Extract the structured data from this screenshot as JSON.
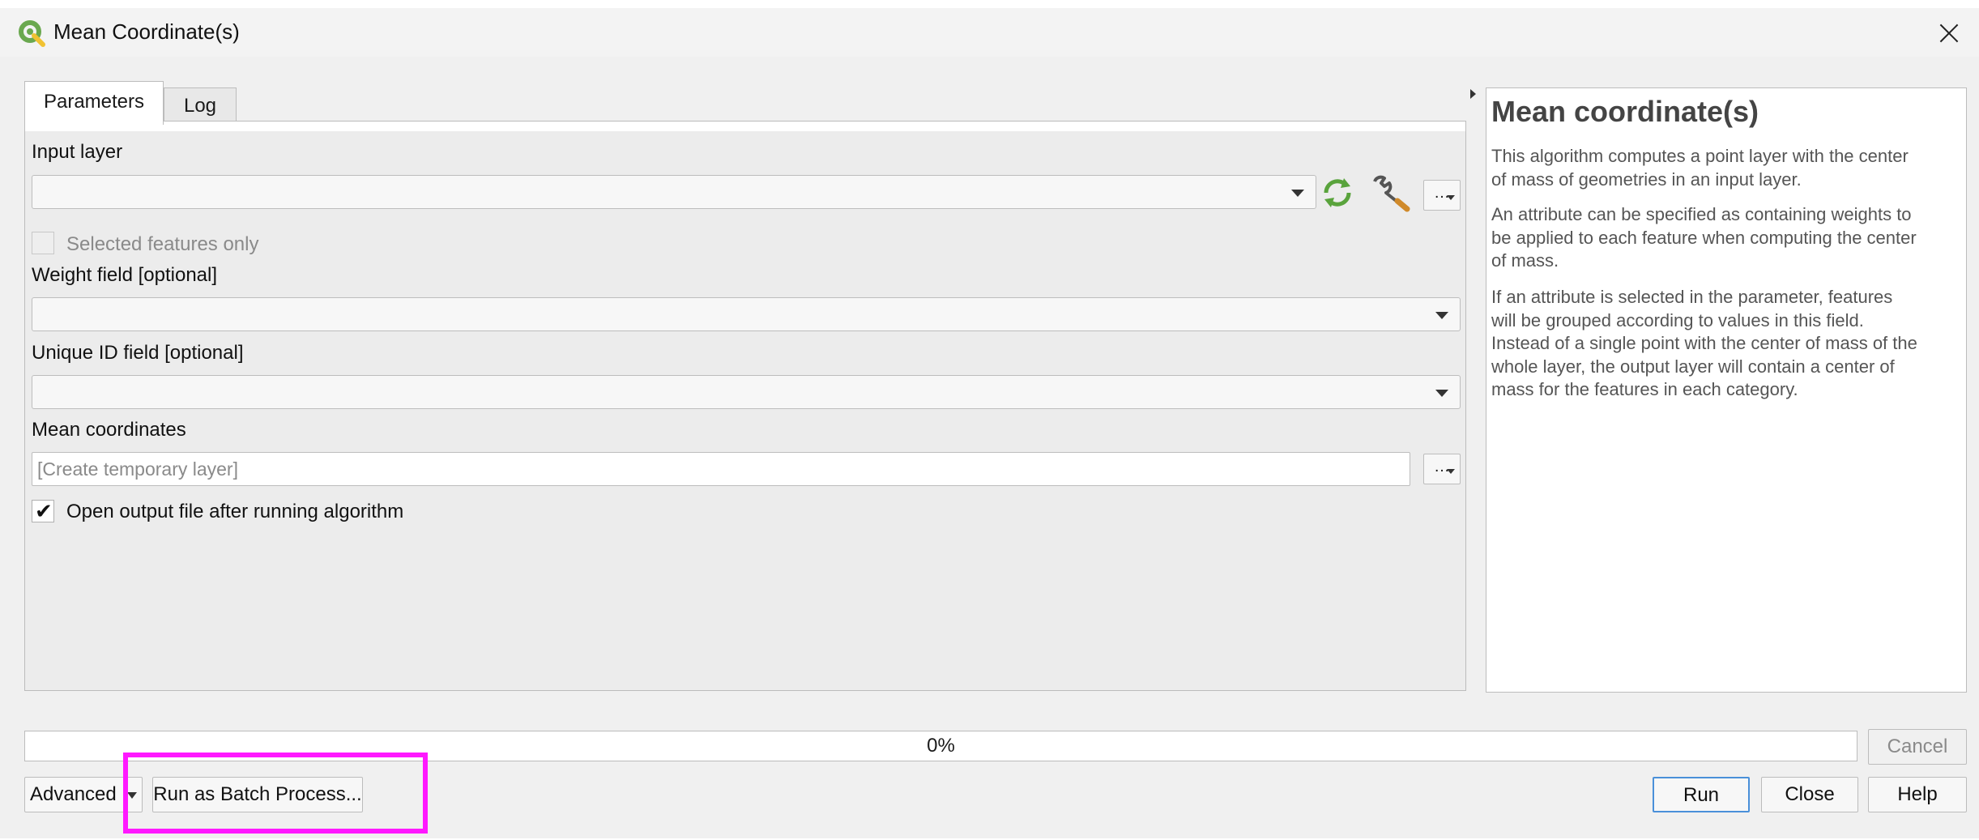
{
  "window": {
    "title": "Mean Coordinate(s)"
  },
  "tabs": [
    {
      "label": "Parameters",
      "active": true
    },
    {
      "label": "Log",
      "active": false
    }
  ],
  "params": {
    "input_layer_label": "Input layer",
    "input_layer_value": "",
    "selected_only_label": "Selected features only",
    "weight_label": "Weight field [optional]",
    "weight_value": "",
    "uid_label": "Unique ID field [optional]",
    "uid_value": "",
    "mean_label": "Mean coordinates",
    "mean_placeholder": "[Create temporary layer]",
    "dots": "…",
    "open_output_label": "Open output file after running algorithm",
    "open_output_checked": true
  },
  "help": {
    "title": "Mean coordinate(s)",
    "p1_lines": [
      "This algorithm computes a point layer with the center",
      "of mass of geometries in an input layer."
    ],
    "p2_lines": [
      "An attribute can be specified as containing weights to",
      "be applied to each feature when computing the center",
      "of mass."
    ],
    "p3_lines": [
      "If an attribute is selected in the parameter, features",
      "will be grouped according to values in this field.",
      "Instead of a single point with the center of mass of the",
      "whole layer, the output layer will contain a center of",
      "mass for the features in each category."
    ]
  },
  "progress": {
    "value": 0,
    "label": "0%"
  },
  "buttons": {
    "cancel": "Cancel",
    "advanced": "Advanced",
    "batch": "Run as Batch Process...",
    "run": "Run",
    "close": "Close",
    "help": "Help"
  },
  "icons": {
    "app": "qgis-logo-icon",
    "refresh": "iterate-refresh-icon",
    "wrench": "wrench-icon",
    "close": "close-icon"
  },
  "colors": {
    "highlight": "#ff19ff",
    "qgis_green": "#6aa84f",
    "default_button": "#4a90d9"
  }
}
